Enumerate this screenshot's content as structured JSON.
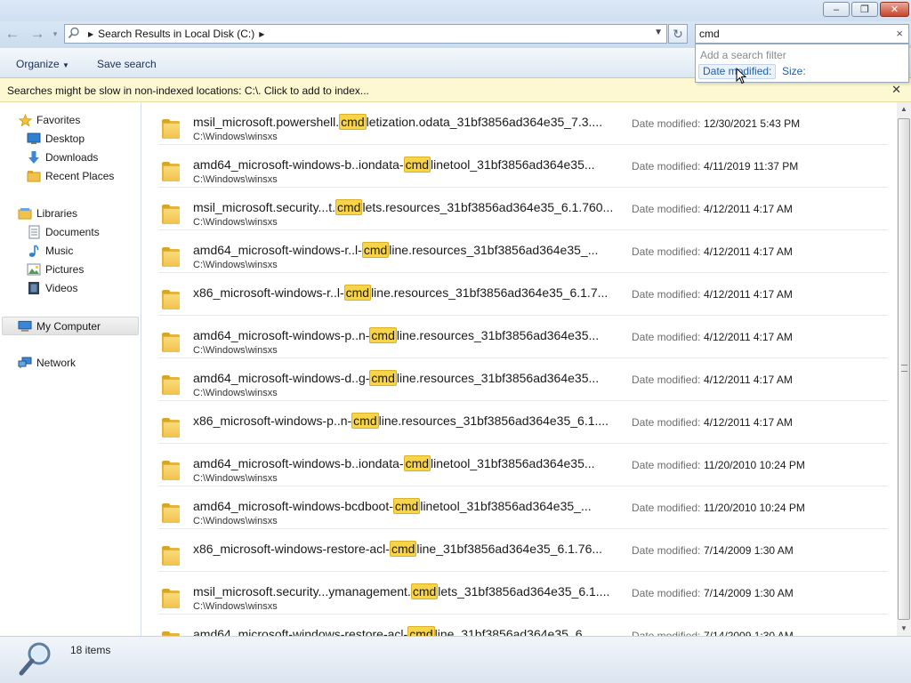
{
  "window": {
    "minimize": "–",
    "maximize": "❐",
    "close": "✕"
  },
  "nav": {
    "back": "←",
    "forward": "→",
    "history": "▾",
    "address": "Search Results in Local Disk (C:)",
    "refresh": "↻"
  },
  "search": {
    "query": "cmd",
    "clear": "×",
    "filter_hint": "Add a search filter",
    "filter_date": "Date modified:",
    "filter_size": "Size:"
  },
  "toolbar": {
    "organize": "Organize",
    "save_search": "Save search"
  },
  "infobar": {
    "message": "Searches might be slow in non-indexed locations: C:\\. Click to add to index...",
    "close": "✕"
  },
  "sidebar": {
    "favorites": "Favorites",
    "desktop": "Desktop",
    "downloads": "Downloads",
    "recent_places": "Recent Places",
    "libraries": "Libraries",
    "documents": "Documents",
    "music": "Music",
    "pictures": "Pictures",
    "videos": "Videos",
    "my_computer": "My Computer",
    "network": "Network"
  },
  "results": {
    "date_label": "Date modified:",
    "items": [
      {
        "pre": "msil_microsoft.powershell.",
        "hl": "cmd",
        "post": "letization.odata_31bf3856ad364e35_7.3....",
        "path": "C:\\Windows\\winsxs",
        "date": "12/30/2021 5:43 PM"
      },
      {
        "pre": "amd64_microsoft-windows-b..iondata-",
        "hl": "cmd",
        "post": "linetool_31bf3856ad364e35...",
        "path": "C:\\Windows\\winsxs",
        "date": "4/11/2019 11:37 PM"
      },
      {
        "pre": "msil_microsoft.security...t.",
        "hl": "cmd",
        "post": "lets.resources_31bf3856ad364e35_6.1.760...",
        "path": "C:\\Windows\\winsxs",
        "date": "4/12/2011 4:17 AM"
      },
      {
        "pre": "amd64_microsoft-windows-r..l-",
        "hl": "cmd",
        "post": "line.resources_31bf3856ad364e35_...",
        "path": "C:\\Windows\\winsxs",
        "date": "4/12/2011 4:17 AM"
      },
      {
        "pre": "x86_microsoft-windows-r..l-",
        "hl": "cmd",
        "post": "line.resources_31bf3856ad364e35_6.1.7...",
        "path": "",
        "date": "4/12/2011 4:17 AM"
      },
      {
        "pre": "amd64_microsoft-windows-p..n-",
        "hl": "cmd",
        "post": "line.resources_31bf3856ad364e35...",
        "path": "C:\\Windows\\winsxs",
        "date": "4/12/2011 4:17 AM"
      },
      {
        "pre": "amd64_microsoft-windows-d..g-",
        "hl": "cmd",
        "post": "line.resources_31bf3856ad364e35...",
        "path": "C:\\Windows\\winsxs",
        "date": "4/12/2011 4:17 AM"
      },
      {
        "pre": "x86_microsoft-windows-p..n-",
        "hl": "cmd",
        "post": "line.resources_31bf3856ad364e35_6.1....",
        "path": "",
        "date": "4/12/2011 4:17 AM"
      },
      {
        "pre": "amd64_microsoft-windows-b..iondata-",
        "hl": "cmd",
        "post": "linetool_31bf3856ad364e35...",
        "path": "C:\\Windows\\winsxs",
        "date": "11/20/2010 10:24 PM"
      },
      {
        "pre": "amd64_microsoft-windows-bcdboot-",
        "hl": "cmd",
        "post": "linetool_31bf3856ad364e35_...",
        "path": "C:\\Windows\\winsxs",
        "date": "11/20/2010 10:24 PM"
      },
      {
        "pre": "x86_microsoft-windows-restore-acl-",
        "hl": "cmd",
        "post": "line_31bf3856ad364e35_6.1.76...",
        "path": "",
        "date": "7/14/2009 1:30 AM"
      },
      {
        "pre": "msil_microsoft.security...ymanagement.",
        "hl": "cmd",
        "post": "lets_31bf3856ad364e35_6.1....",
        "path": "C:\\Windows\\winsxs",
        "date": "7/14/2009 1:30 AM"
      },
      {
        "pre": "amd64_microsoft-windows-restore-acl-",
        "hl": "cmd",
        "post": "line_31bf3856ad364e35_6...",
        "path": "",
        "date": "7/14/2009 1:30 AM"
      }
    ]
  },
  "status": {
    "item_count": "18 items"
  },
  "icons": {
    "search": "search-icon",
    "folder": "folder-icon",
    "star": "star-icon",
    "computer": "computer-icon",
    "network": "network-icon"
  },
  "colors": {
    "highlight": "#f8d449",
    "infobar": "#fdf8d2",
    "folder": "#f1c14c",
    "link": "#1f5faa"
  }
}
